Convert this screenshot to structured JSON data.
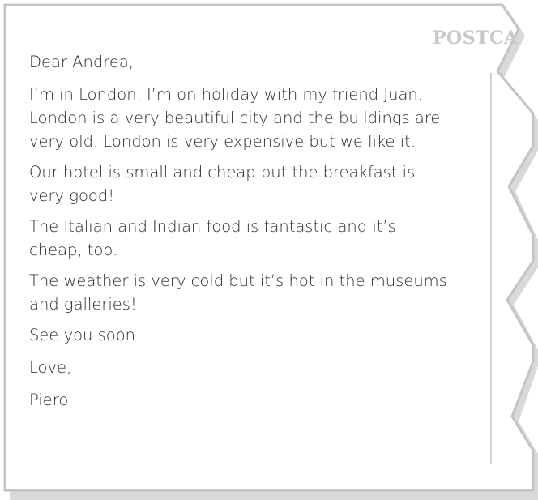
{
  "postcard": {
    "stamp_label": "POSTCA",
    "greeting": "Dear Andrea,",
    "paragraphs": [
      "I’m in London. I’m on holiday with my friend Juan. London is a very beautiful city and the buildings are very old. London is very expensive but we like it.",
      "Our hotel is small and cheap but the breakfast is very good!",
      "The Italian and Indian food is fantastic and it’s cheap, too.",
      "The weather is very cold but it’s hot in the museums and galleries!"
    ],
    "closing": "See you soon",
    "signoff": "Love,",
    "signature": "Piero"
  },
  "colors": {
    "border": "#c8c8c8",
    "text": "#2a2a2a",
    "stamp_text": "#c8c8c8"
  }
}
